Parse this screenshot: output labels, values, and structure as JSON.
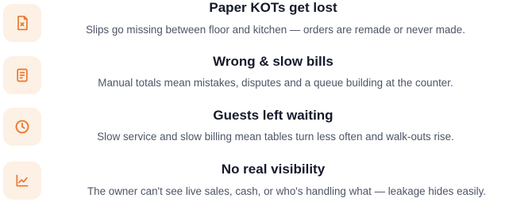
{
  "colors": {
    "accent": "#e8772e",
    "icon_bg": "#fdf0e4",
    "title": "#15192a",
    "text": "#4d5566"
  },
  "problems": [
    {
      "icon": "receipt-x-icon",
      "title": "Paper KOTs get lost",
      "description": "Slips go missing between floor and kitchen — orders are remade or never made."
    },
    {
      "icon": "bill-document-icon",
      "title": "Wrong & slow bills",
      "description": "Manual totals mean mistakes, disputes and a queue building at the counter."
    },
    {
      "icon": "clock-icon",
      "title": "Guests left waiting",
      "description": "Slow service and slow billing mean tables turn less often and walk-outs rise."
    },
    {
      "icon": "trend-chart-icon",
      "title": "No real visibility",
      "description": "The owner can't see live sales, cash, or who's handling what — leakage hides easily."
    }
  ]
}
